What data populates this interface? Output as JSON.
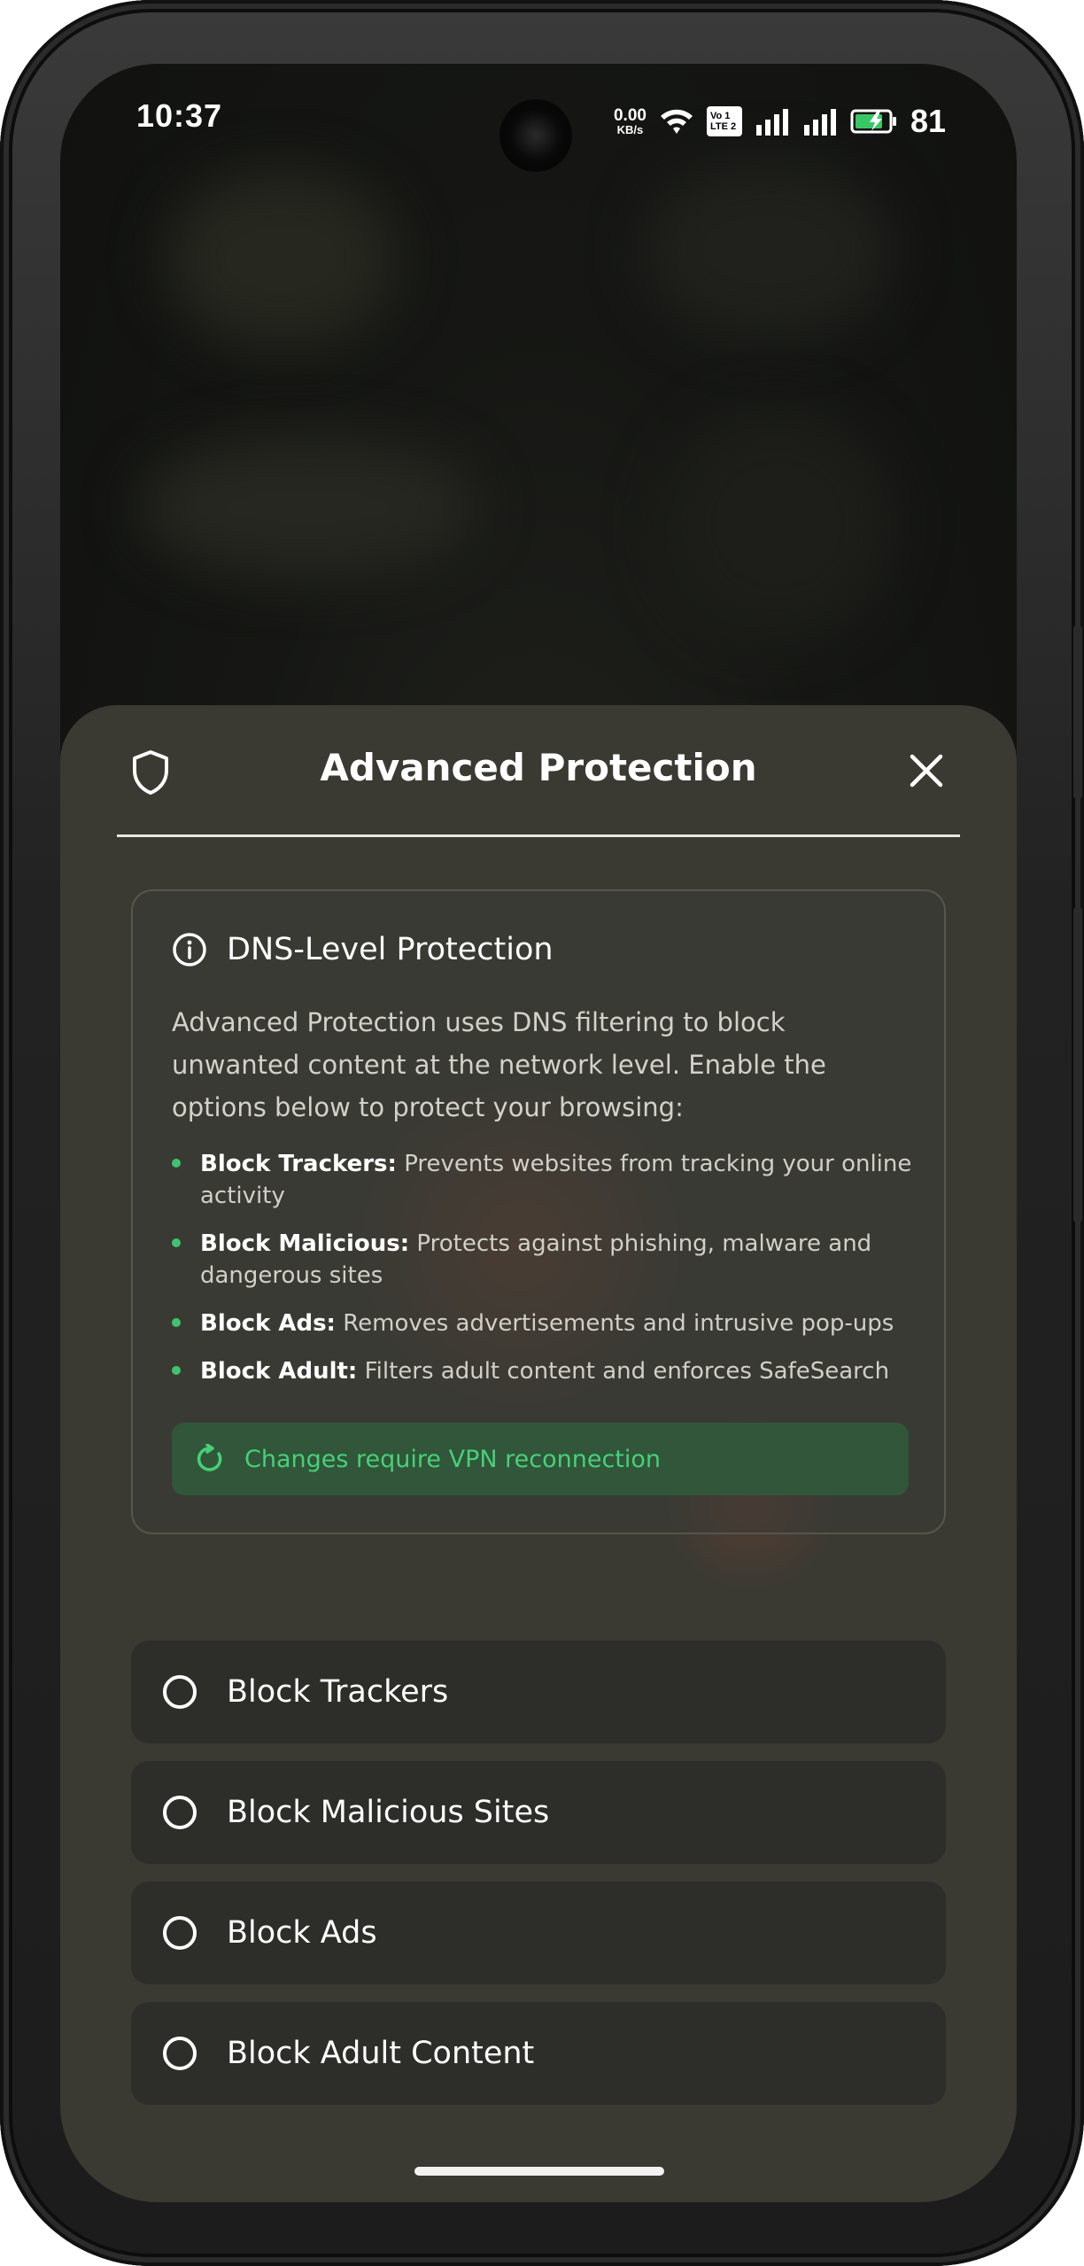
{
  "status_bar": {
    "time": "10:37",
    "net_speed_value": "0.00",
    "net_speed_unit": "KB/s",
    "volte_line1": "Vo  1",
    "volte_line2": "LTE 2",
    "battery_percent": "81",
    "icons": [
      "wifi-icon",
      "volte-icon",
      "signal-icon",
      "signal-icon",
      "battery-charging-icon"
    ]
  },
  "sheet": {
    "title": "Advanced Protection",
    "header_icon": "shield-icon",
    "close_icon": "close-icon"
  },
  "info_card": {
    "icon": "info-icon",
    "title": "DNS-Level Protection",
    "description": "Advanced Protection uses DNS filtering to block unwanted content at the network level. Enable the options below to protect your browsing:",
    "bullets": [
      {
        "label": "Block Trackers:",
        "text": " Prevents websites from tracking your online activity"
      },
      {
        "label": "Block Malicious:",
        "text": " Protects against phishing, malware and dangerous sites"
      },
      {
        "label": "Block Ads:",
        "text": " Removes advertisements and intrusive pop-ups"
      },
      {
        "label": "Block Adult:",
        "text": " Filters adult content and enforces SafeSearch"
      }
    ],
    "notice_icon": "refresh-icon",
    "notice": "Changes require VPN reconnection"
  },
  "options": [
    {
      "label": "Block Trackers",
      "checked": false
    },
    {
      "label": "Block Malicious Sites",
      "checked": false
    },
    {
      "label": "Block Ads",
      "checked": false
    },
    {
      "label": "Block Adult Content",
      "checked": false
    }
  ],
  "colors": {
    "accent_green": "#46d177",
    "notice_bg": "#31563a",
    "sheet_bg": "#3a3a33"
  }
}
